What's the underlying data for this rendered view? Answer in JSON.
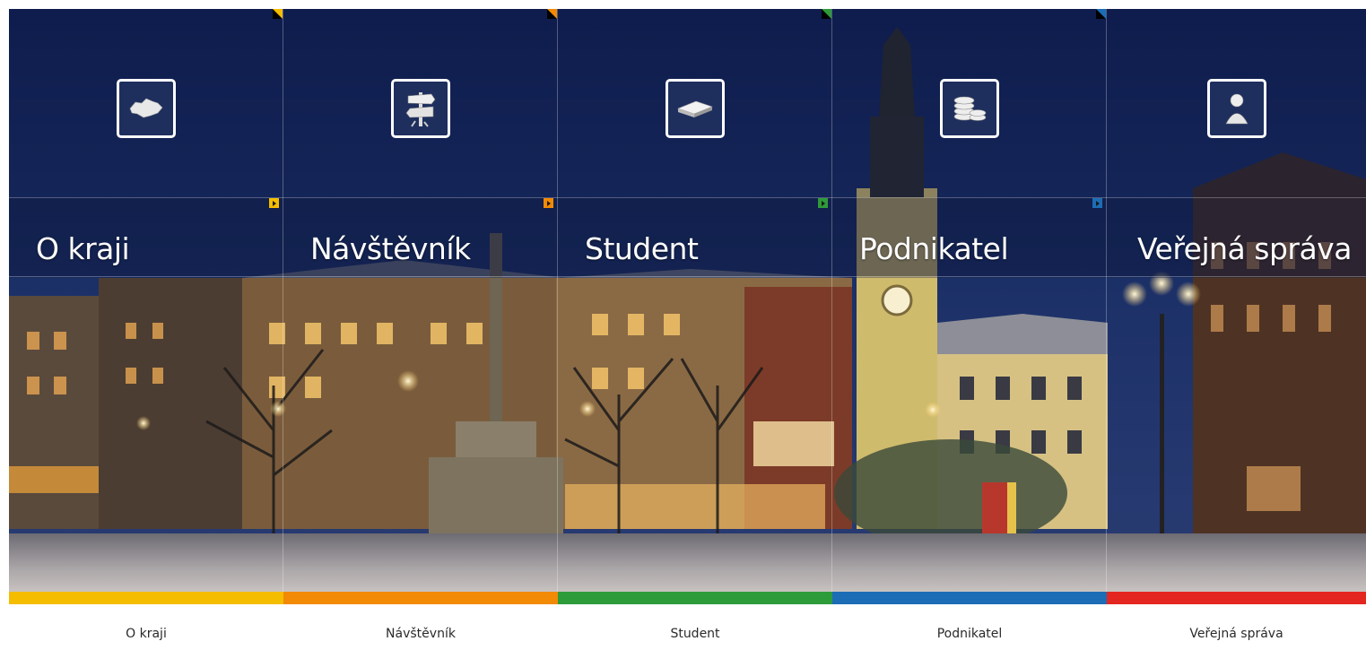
{
  "sections": [
    {
      "key": "o-kraji",
      "label": "O kraji",
      "bottom_label": "O kraji",
      "color": "#f5bd00",
      "icon": "czech-map-icon"
    },
    {
      "key": "navstevnik",
      "label": "Návštěvník",
      "bottom_label": "Návštěvník",
      "color": "#f28a05",
      "icon": "signpost-icon"
    },
    {
      "key": "student",
      "label": "Student",
      "bottom_label": "Student",
      "color": "#2e9b3a",
      "icon": "book-icon"
    },
    {
      "key": "podnikatel",
      "label": "Podnikatel",
      "bottom_label": "Podnikatel",
      "color": "#1c6db5",
      "icon": "coins-icon"
    },
    {
      "key": "verejna-sprava",
      "label": "Veřejná správa",
      "bottom_label": "Veřejná správa",
      "color": "#e3261f",
      "icon": "person-icon"
    }
  ]
}
